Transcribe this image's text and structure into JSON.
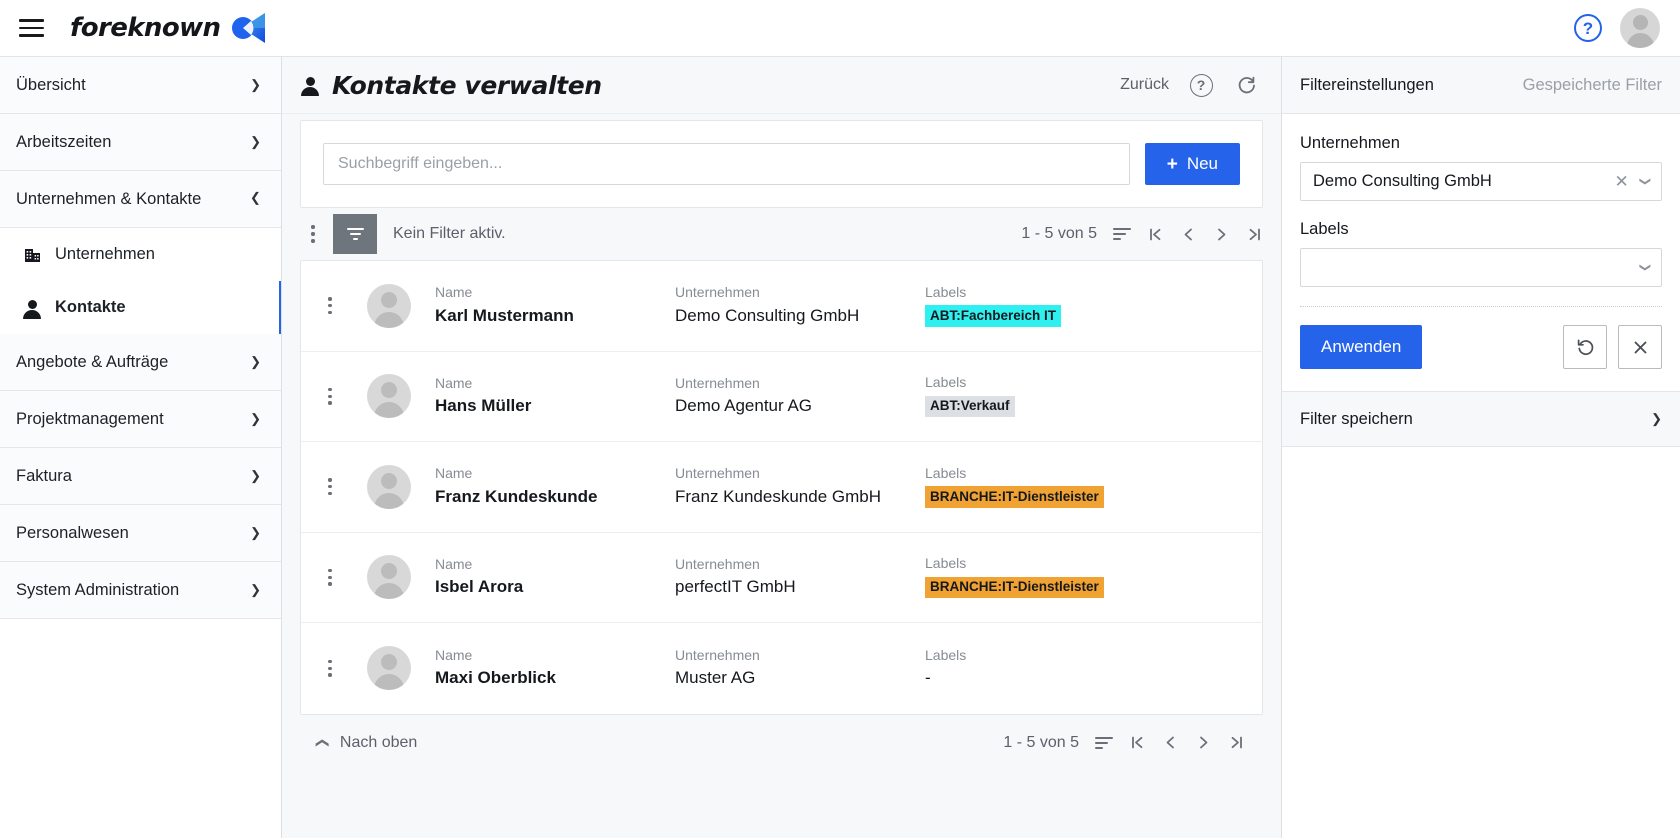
{
  "topbar": {
    "menu_icon": "hamburger-icon",
    "brand": "foreknown",
    "logo_icon": "foreknown-logo-icon",
    "help_icon": "?",
    "avatar_icon": "user-avatar-icon",
    "accent_blue": "#2563eb"
  },
  "sidebar": {
    "groups": [
      {
        "label": "Übersicht",
        "expanded": false
      },
      {
        "label": "Arbeitszeiten",
        "expanded": false
      },
      {
        "label": "Unternehmen & Kontakte",
        "expanded": true
      },
      {
        "label": "Angebote & Aufträge",
        "expanded": false
      },
      {
        "label": "Projektmanagement",
        "expanded": false
      },
      {
        "label": "Faktura",
        "expanded": false
      },
      {
        "label": "Personalwesen",
        "expanded": false
      },
      {
        "label": "System Administration",
        "expanded": false
      }
    ],
    "sub_items": [
      {
        "label": "Unternehmen",
        "icon": "building-icon",
        "active": false
      },
      {
        "label": "Kontakte",
        "icon": "person-icon",
        "active": true
      }
    ]
  },
  "main": {
    "title": "Kontakte verwalten",
    "title_icon": "person-icon",
    "back_label": "Zurück",
    "help_icon": "help-circle-icon",
    "refresh_icon": "refresh-icon",
    "search": {
      "placeholder": "Suchbegriff eingeben...",
      "value": ""
    },
    "new_button": {
      "label": "Neu",
      "icon": "plus-icon"
    },
    "toolbar": {
      "kebab_icon": "more-vertical-icon",
      "filter_icon": "filter-icon",
      "filter_status": "Kein Filter aktiv.",
      "count": "1 - 5 von 5",
      "sort_icon": "sort-icon",
      "first_icon": "first-page-icon",
      "prev_icon": "prev-page-icon",
      "next_icon": "next-page-icon",
      "last_icon": "last-page-icon"
    },
    "columns": {
      "name": "Name",
      "company": "Unternehmen",
      "labels": "Labels"
    },
    "rows": [
      {
        "name": "Karl Mustermann",
        "company": "Demo Consulting GmbH",
        "label": "ABT:Fachbereich IT",
        "label_bg": "#2ff0f0",
        "has_label": true
      },
      {
        "name": "Hans Müller",
        "company": "Demo Agentur AG",
        "label": "ABT:Verkauf",
        "label_bg": "#dcdfe3",
        "has_label": true
      },
      {
        "name": "Franz Kundeskunde",
        "company": "Franz Kundeskunde GmbH",
        "label": "BRANCHE:IT-Dienstleister",
        "label_bg": "#f0a232",
        "has_label": true
      },
      {
        "name": "Isbel Arora",
        "company": "perfectIT GmbH",
        "label": "BRANCHE:IT-Dienstleister",
        "label_bg": "#f0a232",
        "has_label": true
      },
      {
        "name": "Maxi Oberblick",
        "company": "Muster AG",
        "label": "-",
        "label_bg": "transparent",
        "has_label": false
      }
    ],
    "footer": {
      "top_label": "Nach oben",
      "up_icon": "chevron-up-icon",
      "count": "1 - 5 von 5"
    }
  },
  "filter_panel": {
    "tab_settings": "Filtereinstellungen",
    "tab_saved": "Gespeicherte Filter",
    "company_label": "Unternehmen",
    "company_value": "Demo Consulting GmbH",
    "company_clear_icon": "clear-x-icon",
    "company_caret_icon": "chevron-down-icon",
    "labels_label": "Labels",
    "labels_value": "",
    "labels_caret_icon": "chevron-down-icon",
    "apply_label": "Anwenden",
    "reset_icon": "undo-icon",
    "clear_icon": "close-x-icon",
    "save_filter_label": "Filter speichern",
    "save_chevron_icon": "chevron-down-icon"
  }
}
